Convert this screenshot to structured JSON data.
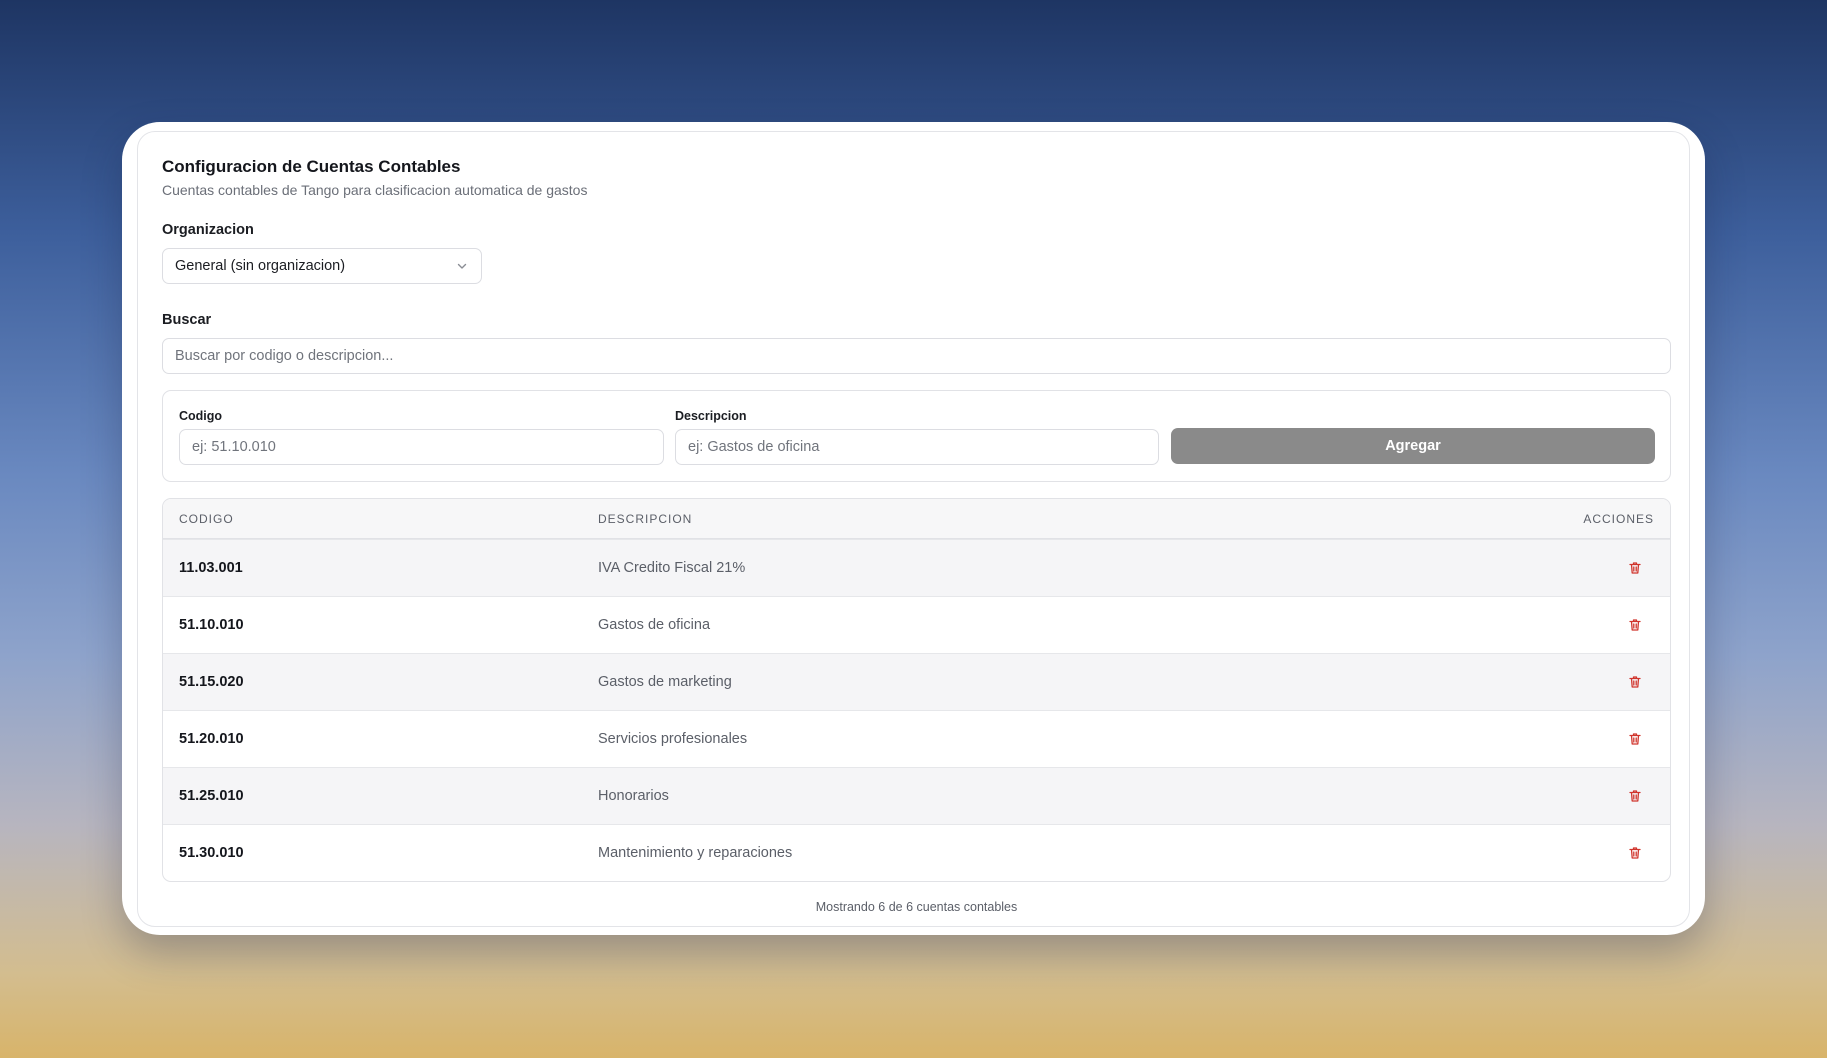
{
  "page": {
    "title": "Configuracion de Cuentas Contables",
    "subtitle": "Cuentas contables de Tango para clasificacion automatica de gastos"
  },
  "organization": {
    "label": "Organizacion",
    "selected": "General (sin organizacion)"
  },
  "search": {
    "label": "Buscar",
    "placeholder": "Buscar por codigo o descripcion..."
  },
  "add_form": {
    "code_label": "Codigo",
    "code_placeholder": "ej: 51.10.010",
    "description_label": "Descripcion",
    "description_placeholder": "ej: Gastos de oficina",
    "button_label": "Agregar"
  },
  "table": {
    "headers": {
      "code": "CODIGO",
      "description": "DESCRIPCION",
      "actions": "ACCIONES"
    },
    "rows": [
      {
        "code": "11.03.001",
        "description": "IVA Credito Fiscal 21%"
      },
      {
        "code": "51.10.010",
        "description": "Gastos de oficina"
      },
      {
        "code": "51.15.020",
        "description": "Gastos de marketing"
      },
      {
        "code": "51.20.010",
        "description": "Servicios profesionales"
      },
      {
        "code": "51.25.010",
        "description": "Honorarios"
      },
      {
        "code": "51.30.010",
        "description": "Mantenimiento y reparaciones"
      }
    ]
  },
  "footer": {
    "text": "Mostrando 6 de 6 cuentas contables"
  },
  "colors": {
    "delete_icon": "#d0342c",
    "add_button": "#8a8a8a"
  },
  "icons": {
    "row_action": "trash-icon",
    "select": "chevron-down-icon"
  }
}
